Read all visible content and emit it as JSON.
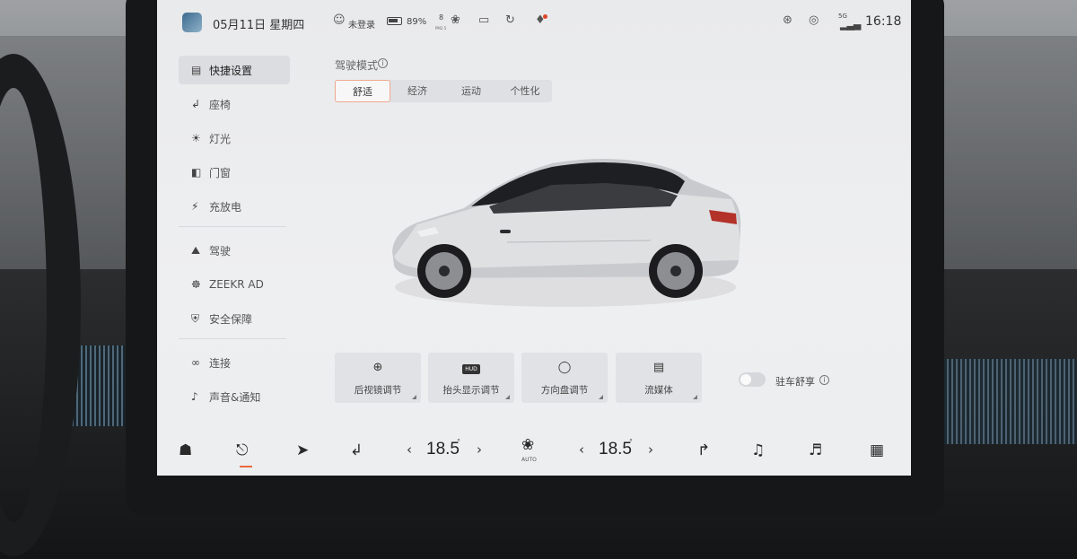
{
  "status_bar": {
    "date": "05月11日 星期四",
    "user": "未登录",
    "battery": "89%",
    "pm_value": "8",
    "pm_unit": "PM2.5",
    "time": "16:18",
    "signal": "5G"
  },
  "sidebar": {
    "items": [
      {
        "label": "快捷设置",
        "icon": "toggle-icon",
        "active": true
      },
      {
        "label": "座椅",
        "icon": "seat-icon"
      },
      {
        "label": "灯光",
        "icon": "light-icon"
      },
      {
        "label": "门窗",
        "icon": "door-icon"
      },
      {
        "label": "充放电",
        "icon": "bolt-icon"
      },
      {
        "label": "驾驶",
        "icon": "car-icon"
      },
      {
        "label": "ZEEKR AD",
        "icon": "steering-wheel-icon"
      },
      {
        "label": "安全保障",
        "icon": "shield-icon"
      },
      {
        "label": "连接",
        "icon": "link-icon"
      },
      {
        "label": "声音&通知",
        "icon": "speaker-icon"
      }
    ]
  },
  "drive_mode": {
    "label": "驾驶模式",
    "tabs": [
      "舒适",
      "经济",
      "运动",
      "个性化"
    ],
    "selected": "舒适"
  },
  "quick_buttons": [
    {
      "label": "后视镜调节",
      "icon": "mirror-icon"
    },
    {
      "label": "抬头显示调节",
      "icon": "hud-icon"
    },
    {
      "label": "方向盘调节",
      "icon": "steering-wheel-icon"
    },
    {
      "label": "流媒体",
      "icon": "stream-icon"
    }
  ],
  "parking_comfort": {
    "label": "驻车舒享",
    "on": false
  },
  "dock": {
    "left_temp": "18.5",
    "right_temp": "18.5",
    "fan_mode": "AUTO",
    "hud_badge": "HUD"
  },
  "colors": {
    "accent": "#e86a3c",
    "screen_bg": "#ecedef",
    "active_tab_border": "#f0a98e"
  }
}
